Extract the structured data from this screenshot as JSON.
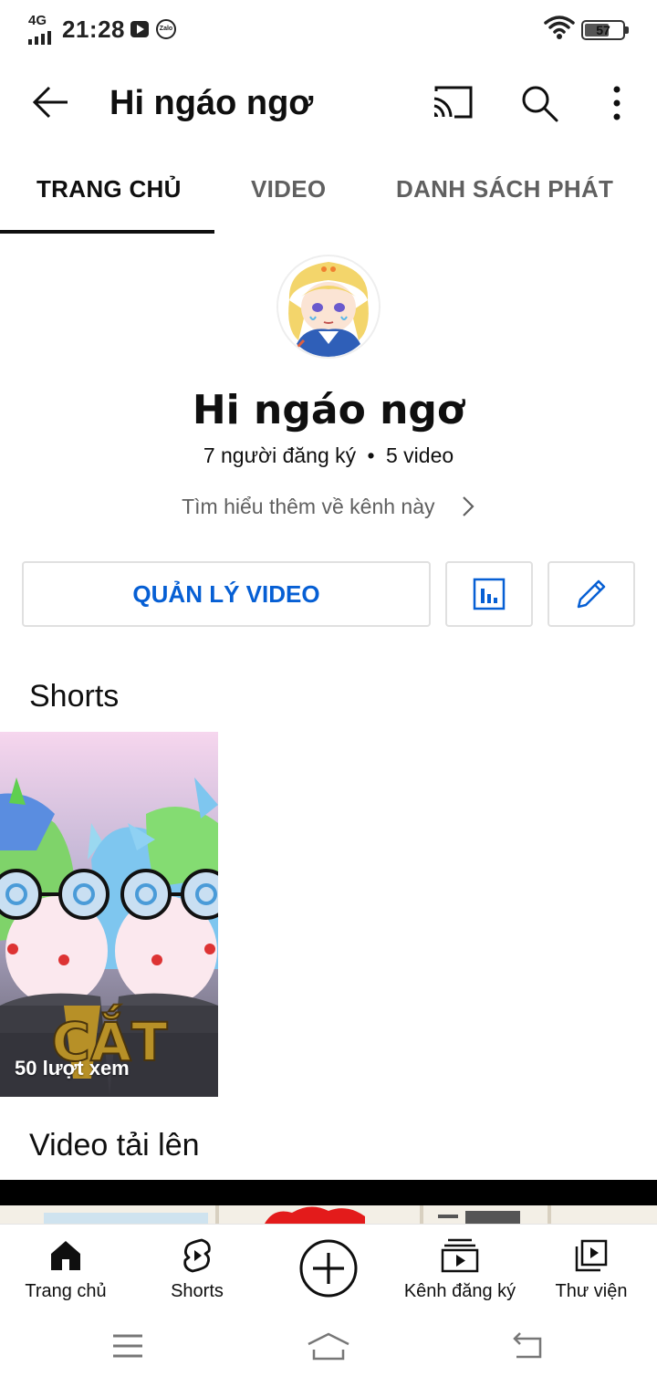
{
  "status_bar": {
    "network": "4G",
    "time": "21:28",
    "battery": "57",
    "icons": [
      "signal-icon",
      "youtube-notification-icon",
      "zalo-notification-icon",
      "wifi-icon",
      "battery-icon"
    ]
  },
  "top_bar": {
    "title": "Hi ngáo ngơ",
    "icons": [
      "back-arrow-icon",
      "cast-icon",
      "search-icon",
      "more-vertical-icon"
    ]
  },
  "tabs": [
    {
      "label": "TRANG CHỦ",
      "active": true
    },
    {
      "label": "VIDEO",
      "active": false
    },
    {
      "label": "DANH SÁCH PHÁT",
      "active": false
    }
  ],
  "channel": {
    "name": "Hi ngáo ngơ",
    "subscribers": "7 người đăng ký",
    "separator": "•",
    "video_count": "5 video",
    "about_link": "Tìm hiểu thêm về kênh này"
  },
  "actions": {
    "manage_videos": "QUẢN LÝ VIDEO",
    "accent_color": "#065fd4"
  },
  "shorts": {
    "title": "Shorts",
    "items": [
      {
        "views": "50 lượt xem",
        "thumbnail_text": "CẮT"
      }
    ]
  },
  "uploads": {
    "title": "Video tải lên"
  },
  "bottom_nav": [
    {
      "label": "Trang chủ",
      "icon": "home-icon"
    },
    {
      "label": "Shorts",
      "icon": "shorts-icon"
    },
    {
      "label": "",
      "icon": "create-plus-icon"
    },
    {
      "label": "Kênh đăng ký",
      "icon": "subscriptions-icon"
    },
    {
      "label": "Thư viện",
      "icon": "library-icon"
    }
  ],
  "system_nav": [
    "menu-icon",
    "home-button-icon",
    "back-button-icon"
  ]
}
